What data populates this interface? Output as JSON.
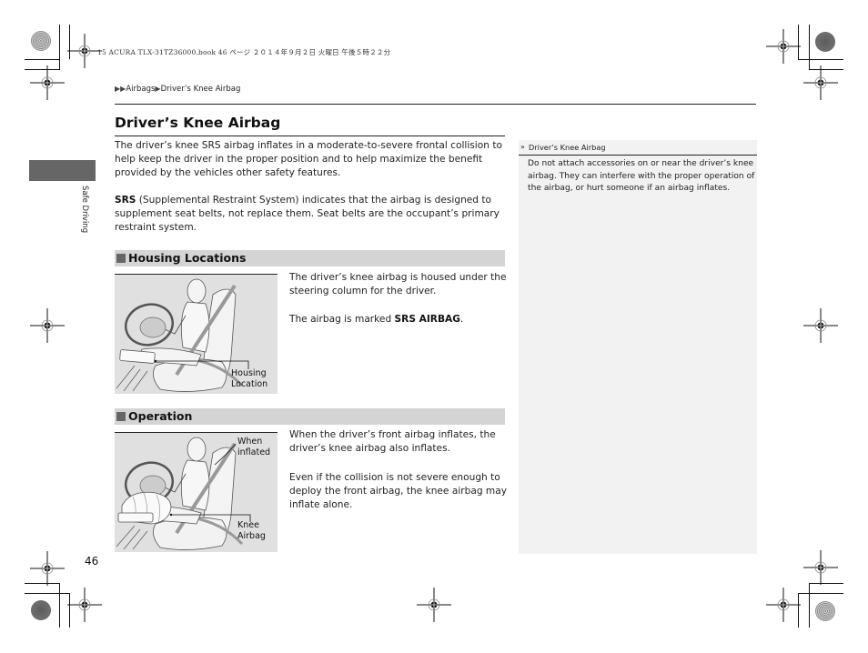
{
  "print_header": {
    "text": "15 ACURA TLX-31TZ36000.book  46 ページ  ２０１４年９月２日  火曜日  午後５時２２分"
  },
  "breadcrumb": {
    "prefix_icon": "double-arrow-right-icon",
    "items": [
      "Airbags",
      "Driver’s Knee Airbag"
    ],
    "separator_icon": "arrow-right-icon"
  },
  "side_tab": {
    "label": "Safe Driving"
  },
  "page": {
    "title": "Driver’s Knee Airbag",
    "intro": "The driver’s knee SRS airbag inflates in a moderate-to-severe frontal collision to help keep the driver in the proper position and to help maximize the benefit provided by the vehicles other safety features.",
    "srs_term": "SRS",
    "srs_text": " (Supplemental Restraint System) indicates that the airbag is designed to supplement seat belts, not replace them. Seat belts are the occupant’s primary restraint system."
  },
  "sections": [
    {
      "heading": "Housing Locations",
      "paragraph1": "The driver’s knee airbag is housed under the steering column for the driver.",
      "paragraph2_prefix": "The airbag is marked ",
      "paragraph2_bold": "SRS AIRBAG",
      "paragraph2_suffix": ".",
      "figure_labels": [
        "Housing",
        "Location"
      ]
    },
    {
      "heading": "Operation",
      "paragraph1": "When the driver’s front airbag inflates, the driver’s knee airbag also inflates.",
      "paragraph2": "Even if the collision is not severe enough to deploy the front airbag, the knee airbag may inflate alone.",
      "figure_labels_top": [
        "When",
        "inflated"
      ],
      "figure_labels_bottom": [
        "Knee",
        "Airbag"
      ]
    }
  ],
  "note": {
    "icon": "reference-double-chevron-icon",
    "heading": "Driver’s Knee Airbag",
    "body": "Do not attach accessories on or near the driver’s knee airbag. They can interfere with the proper operation of the airbag, or hurt someone if an airbag inflates."
  },
  "page_number": "46",
  "colors": {
    "section_bar": "#d4d4d4",
    "section_square": "#666666",
    "side_tab": "#666666",
    "note_background": "#f2f2f2",
    "figure_background": "#e0e0e0"
  }
}
